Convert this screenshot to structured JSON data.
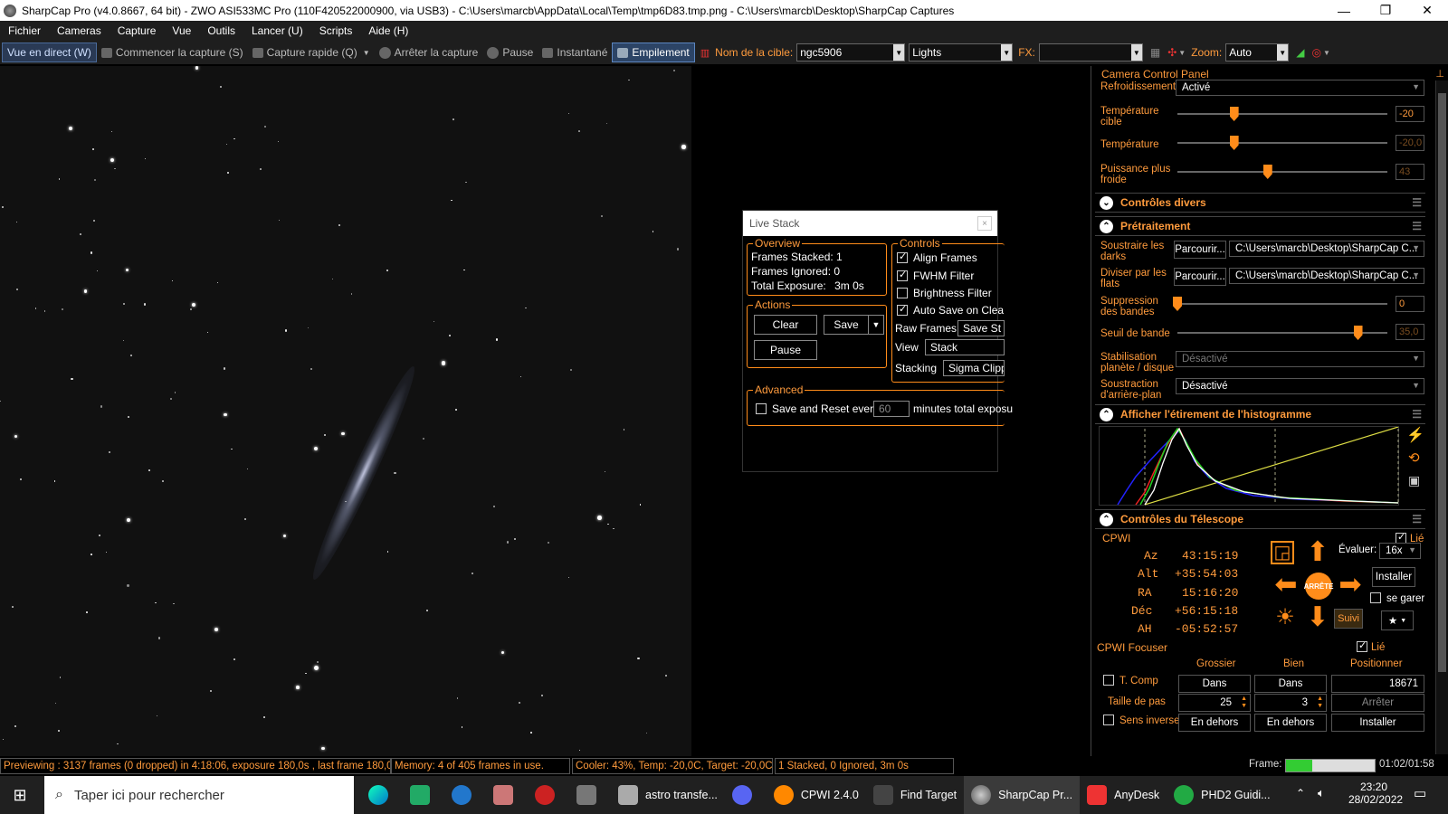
{
  "window": {
    "title": "SharpCap Pro (v4.0.8667, 64 bit) - ZWO ASI533MC Pro (110F420522000900, via USB3) - C:\\Users\\marcb\\AppData\\Local\\Temp\\tmp6D83.tmp.png - C:\\Users\\marcb\\Desktop\\SharpCap Captures",
    "minimize": "—",
    "maximize": "❐",
    "close": "✕"
  },
  "menu": [
    "Fichier",
    "Cameras",
    "Capture",
    "Vue",
    "Outils",
    "Lancer (U)",
    "Scripts",
    "Aide (H)"
  ],
  "toolbar": {
    "live_view": "Vue en direct (W)",
    "start_capture": "Commencer la capture (S)",
    "quick_capture": "Capture rapide (Q)",
    "stop_capture": "Arrêter la capture",
    "pause": "Pause",
    "snapshot": "Instantané",
    "stacking": "Empilement",
    "target_label": "Nom de la cible:",
    "target_value": "ngc5906",
    "frame_type": "Lights",
    "fx_label": "FX:",
    "fx_value": "",
    "zoom_label": "Zoom:",
    "zoom_value": "Auto"
  },
  "live_stack": {
    "title": "Live Stack",
    "close": "×",
    "overview": {
      "title": "Overview",
      "frames_stacked_label": "Frames Stacked:",
      "frames_stacked": "1",
      "frames_ignored_label": "Frames Ignored:",
      "frames_ignored": "0",
      "total_exposure_label": "Total Exposure:",
      "total_exposure": "3m 0s"
    },
    "actions": {
      "title": "Actions",
      "clear": "Clear",
      "save": "Save",
      "pause": "Pause"
    },
    "controls": {
      "title": "Controls",
      "align_frames": "Align Frames",
      "align_frames_checked": true,
      "fwhm_filter": "FWHM Filter",
      "fwhm_filter_checked": true,
      "brightness_filter": "Brightness Filter",
      "brightness_filter_checked": false,
      "auto_save": "Auto Save on Clea",
      "auto_save_checked": true,
      "raw_frames_label": "Raw Frames",
      "raw_frames_value": "Save St",
      "view_label": "View",
      "view_value": "Stack",
      "stacking_label": "Stacking",
      "stacking_value": "Sigma Clipp"
    },
    "advanced": {
      "title": "Advanced",
      "save_reset_label": "Save and Reset every",
      "save_reset_value": "60",
      "minutes_label": "minutes total exposu"
    }
  },
  "camera_panel": {
    "title": "Camera Control Panel",
    "pin": "⊥",
    "cooling_label": "Refroidissement",
    "cooling_value": "Activé",
    "target_temp_label": "Température cible",
    "target_temp_value": "-20",
    "target_temp_fraction": 0.27,
    "temp_label": "Température",
    "temp_value": "-20,0",
    "temp_fraction": 0.27,
    "cooler_power_label": "Puissance plus froide",
    "cooler_power_value": "43",
    "cooler_power_fraction": 0.43,
    "misc_section": "Contrôles divers",
    "preprocess_section": "Prétraitement",
    "darks_label": "Soustraire les darks",
    "darks_browse": "Parcourir...",
    "darks_path": "C:\\Users\\marcb\\Desktop\\SharpCap C...",
    "flats_label": "Diviser par les flats",
    "flats_browse": "Parcourir...",
    "flats_path": "C:\\Users\\marcb\\Desktop\\SharpCap C...",
    "banding_label": "Suppression des bandes",
    "banding_value": "0",
    "banding_fraction": 0.0,
    "band_threshold_label": "Seuil de bande",
    "band_threshold_value": "35,0",
    "band_threshold_fraction": 0.86,
    "stabilization_label": "Stabilisation planète / disque",
    "stabilization_value": "Désactivé",
    "background_label": "Soustraction d'arrière-plan",
    "background_value": "Désactivé",
    "histogram_section": "Afficher l'étirement de l'histogramme",
    "telescope_section": "Contrôles du Télescope",
    "mount_name": "CPWI",
    "linked_label": "Lié",
    "az_label": "Az",
    "az_value": "43:15:19",
    "alt_label": "Alt",
    "alt_value": "+35:54:03",
    "ra_label": "RA",
    "ra_value": "15:16:20",
    "dec_label": "Déc",
    "dec_value": "+56:15:18",
    "ah_label": "AH",
    "ah_value": "-05:52:57",
    "rate_label": "Évaluer:",
    "rate_value": "16x",
    "stop_label": "ARRÊTE",
    "install_label": "Installer",
    "park_label": "se garer",
    "track_label": "Suivi",
    "focuser_title": "CPWI Focuser",
    "focuser_linked": "Lié",
    "coarse_label": "Grossier",
    "fine_label": "Bien",
    "position_label": "Positionner",
    "tcomp_label": "T. Comp",
    "in_label": "Dans",
    "out_label": "En dehors",
    "position_value": "18671",
    "step_label": "Taille de pas",
    "coarse_step": "25",
    "fine_step": "3",
    "stop_button": "Arrêter",
    "reverse_label": "Sens inverse",
    "install_button": "Installer"
  },
  "status": {
    "preview": "Previewing : 3137 frames (0 dropped) in 4:18:06, exposure 180,0s , last frame 180,0",
    "memory": "Memory: 4 of 405 frames in use.",
    "cooler": "Cooler: 43%, Temp: -20,0C, Target: -20,0C",
    "stacked": "1 Stacked, 0 Ignored, 3m 0s",
    "frame_label": "Frame:",
    "frame_time": "01:02/01:58",
    "frame_progress": 0.3
  },
  "taskbar": {
    "search_placeholder": "Taper ici pour rechercher",
    "apps": [
      "astro transfe...",
      "CPWI 2.4.0",
      "Find Target",
      "SharpCap Pr...",
      "AnyDesk",
      "PHD2 Guidi..."
    ],
    "time": "23:20",
    "date": "28/02/2022"
  }
}
